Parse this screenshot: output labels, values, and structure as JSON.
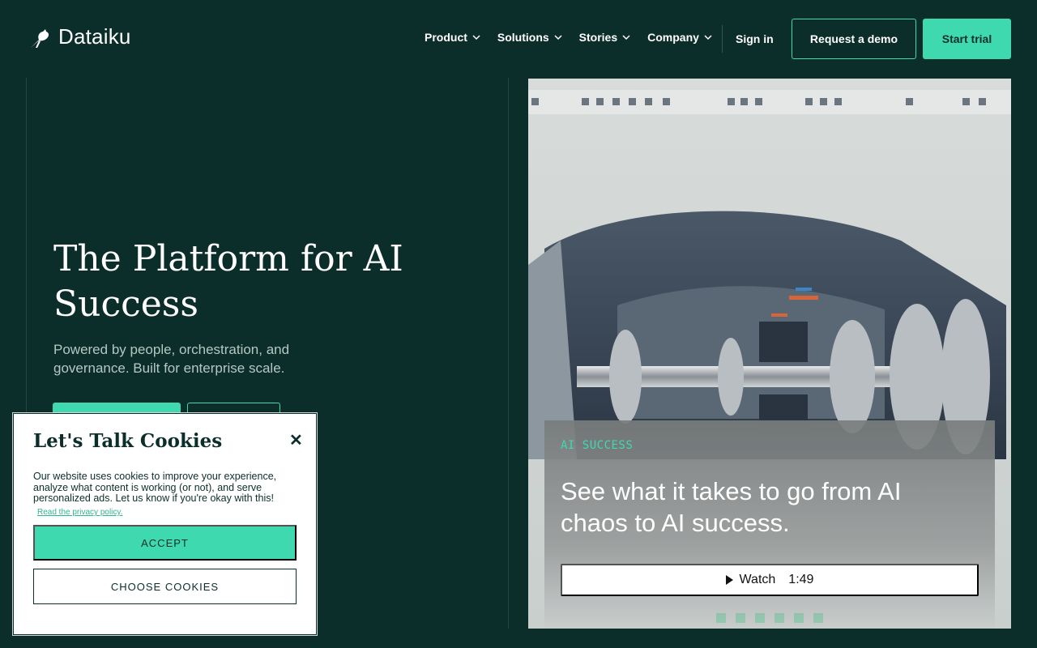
{
  "nav": {
    "logo_text": "Dataiku",
    "menu": [
      {
        "label": "Product"
      },
      {
        "label": "Solutions"
      },
      {
        "label": "Stories"
      },
      {
        "label": "Company"
      }
    ],
    "sign_in": "Sign in",
    "request_demo": "Request a demo",
    "start_trial": "Start trial"
  },
  "hero": {
    "title": "The Platform for AI Success",
    "subtitle": "Powered by people, orchestration, and governance. Built for enterprise scale."
  },
  "media": {
    "tag": "AI SUCCESS",
    "title": "See what it takes to go from AI chaos to AI success.",
    "watch_label": "Watch",
    "duration": "1:49"
  },
  "cookie": {
    "title": "Let's Talk Cookies",
    "close_glyph": "✕",
    "body": "Our website uses cookies to improve your experience, analyze what content is working (or not), and serve personalized ads. Let us know if you're okay with this!",
    "privacy_link": "Read the privacy policy.",
    "accept": "ACCEPT",
    "choose": "CHOOSE COOKIES"
  },
  "colors": {
    "background": "#0c2e2a",
    "accent": "#3fd9b0"
  }
}
